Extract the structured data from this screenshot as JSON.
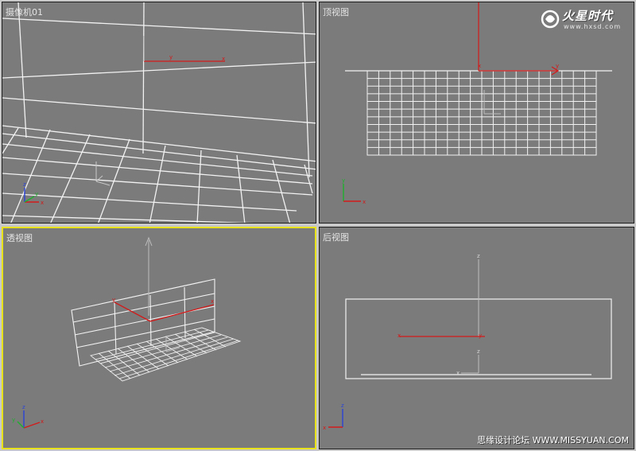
{
  "viewports": {
    "camera": {
      "label": "摄像机01"
    },
    "top": {
      "label": "顶视图"
    },
    "perspective": {
      "label": "透视图"
    },
    "back": {
      "label": "后视图"
    }
  },
  "axis_labels": {
    "x": "x",
    "y": "y",
    "z": "z"
  },
  "watermark": {
    "brand": "火星时代",
    "url": "www.hxsd.com"
  },
  "credit": {
    "text": "思缘设计论坛 WWW.MISSYUAN.COM"
  },
  "colors": {
    "viewport_bg": "#7b7b7b",
    "active_border": "#e8e21d",
    "wire": "#ffffff",
    "axis_x": "#d31a1a",
    "axis_y": "#1fb02d",
    "axis_z": "#2a43d8"
  }
}
